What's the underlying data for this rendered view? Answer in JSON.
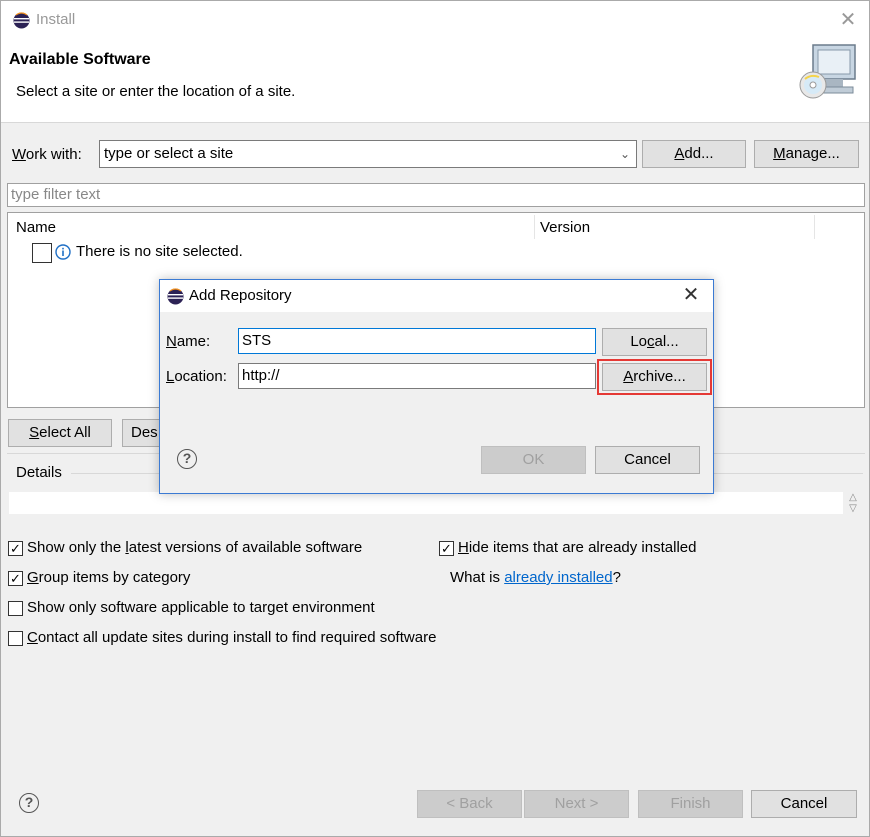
{
  "window": {
    "title": "Install",
    "close_label": "✕"
  },
  "header": {
    "title": "Available Software",
    "description": "Select a site or enter the location of a site."
  },
  "work_with": {
    "label_prefix": "W",
    "label_rest": "ork with:",
    "combo_placeholder": "type or select a site",
    "add_button_u": "A",
    "add_button_rest": "dd...",
    "manage_button_u": "M",
    "manage_button_rest": "anage..."
  },
  "filter": {
    "placeholder": "type filter text"
  },
  "tree": {
    "columns": [
      "Name",
      "Version"
    ],
    "empty_message": "There is no site selected."
  },
  "selection_buttons": {
    "select_all_u": "S",
    "select_all_rest": "elect All",
    "deselect_visible": "Des"
  },
  "details": {
    "label": "Details"
  },
  "options": {
    "show_latest_pre": "Show only the ",
    "show_latest_u": "l",
    "show_latest_post": "atest versions of available software",
    "show_latest_checked": true,
    "group_u": "G",
    "group_rest": "roup items by category",
    "group_checked": true,
    "applicable": "Show only software applicable to target environment",
    "applicable_checked": false,
    "contact_u": "C",
    "contact_rest": "ontact all update sites during install to find required software",
    "contact_checked": false,
    "hide_u": "H",
    "hide_rest": "ide items that are already installed",
    "hide_checked": true,
    "what_is_prefix": "What is ",
    "what_is_link": "already installed",
    "what_is_suffix": "?"
  },
  "footer": {
    "back": "< Back",
    "next": "Next >",
    "finish": "Finish",
    "cancel": "Cancel"
  },
  "dialog": {
    "title": "Add Repository",
    "close_label": "✕",
    "name_label_u": "N",
    "name_label_rest": "ame:",
    "name_value": "STS",
    "location_label_u": "L",
    "location_label_rest": "ocation:",
    "location_value": "http://",
    "local_button_pre": "Lo",
    "local_button_u": "c",
    "local_button_post": "al...",
    "archive_button_u": "A",
    "archive_button_rest": "rchive...",
    "ok_button": "OK",
    "cancel_button": "Cancel"
  },
  "colors": {
    "highlight": "#e53935",
    "link": "#0066cc",
    "dialog_border": "#3b7ad3"
  }
}
